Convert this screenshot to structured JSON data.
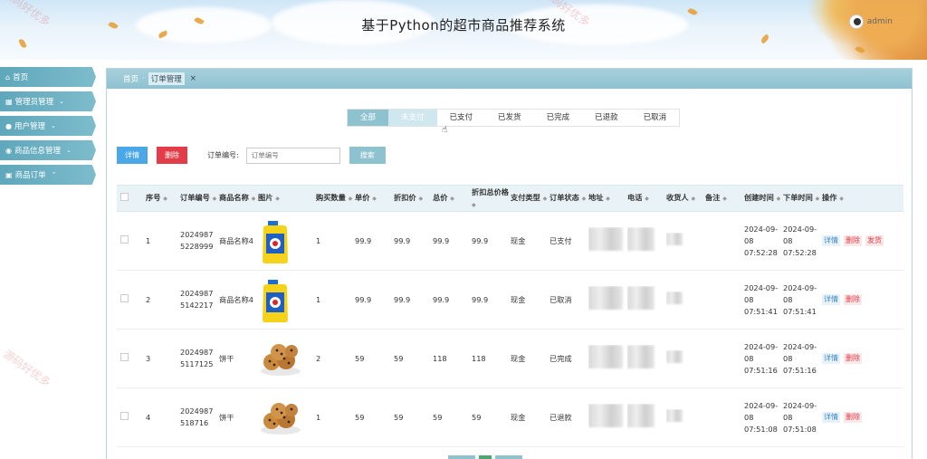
{
  "header": {
    "title": "基于Python的超市商品推荐系统",
    "username": "admin"
  },
  "watermark_text": "源码好优多",
  "sidebar": {
    "items": [
      {
        "label": "首页",
        "icon": "home-icon"
      },
      {
        "label": "管理员管理",
        "icon": "grid-icon"
      },
      {
        "label": "用户管理",
        "icon": "user-icon"
      },
      {
        "label": "商品信息管理",
        "icon": "circle-icon"
      },
      {
        "label": "商品订单",
        "icon": "store-icon"
      }
    ]
  },
  "breadcrumb": {
    "home": "首页",
    "current": "订单管理"
  },
  "status_tabs": [
    "全部",
    "未支付",
    "已支付",
    "已发货",
    "已完成",
    "已退款",
    "已取消"
  ],
  "toolbar": {
    "detail_label": "详情",
    "delete_label": "删除",
    "order_label": "订单编号:",
    "order_placeholder": "订单编号",
    "search_label": "搜索"
  },
  "table": {
    "headers": [
      "序号",
      "订单编号",
      "商品名称",
      "图片",
      "购买数量",
      "单价",
      "折扣价",
      "总价",
      "折扣总价格",
      "支付类型",
      "订单状态",
      "地址",
      "电话",
      "收货人",
      "备注",
      "创建时间",
      "下单时间",
      "操作"
    ],
    "rows": [
      {
        "no": "1",
        "order_no": "20249875228999",
        "name": "商品名称4",
        "image": "bottle",
        "qty": "1",
        "price": "99.9",
        "discount": "99.9",
        "total": "99.9",
        "discount_total": "99.9",
        "pay": "现金",
        "status": "已支付",
        "created": "2024-09-08 07:52:28",
        "ordered": "2024-09-08 07:52:28",
        "ops": [
          "详情",
          "删除",
          "发货"
        ]
      },
      {
        "no": "2",
        "order_no": "20249875142217",
        "name": "商品名称4",
        "image": "bottle",
        "qty": "1",
        "price": "99.9",
        "discount": "99.9",
        "total": "99.9",
        "discount_total": "99.9",
        "pay": "现金",
        "status": "已取消",
        "created": "2024-09-08 07:51:41",
        "ordered": "2024-09-08 07:51:41",
        "ops": [
          "详情",
          "删除"
        ]
      },
      {
        "no": "3",
        "order_no": "20249875117125",
        "name": "饼干",
        "image": "cookies",
        "qty": "2",
        "price": "59",
        "discount": "59",
        "total": "118",
        "discount_total": "118",
        "pay": "现金",
        "status": "已完成",
        "created": "2024-09-08 07:51:16",
        "ordered": "2024-09-08 07:51:16",
        "ops": [
          "详情",
          "删除"
        ]
      },
      {
        "no": "4",
        "order_no": "2024987518716",
        "name": "饼干",
        "image": "cookies",
        "qty": "1",
        "price": "59",
        "discount": "59",
        "total": "59",
        "discount_total": "59",
        "pay": "现金",
        "status": "已退款",
        "created": "2024-09-08 07:51:08",
        "ordered": "2024-09-08 07:51:08",
        "ops": [
          "详情",
          "删除"
        ]
      }
    ]
  }
}
